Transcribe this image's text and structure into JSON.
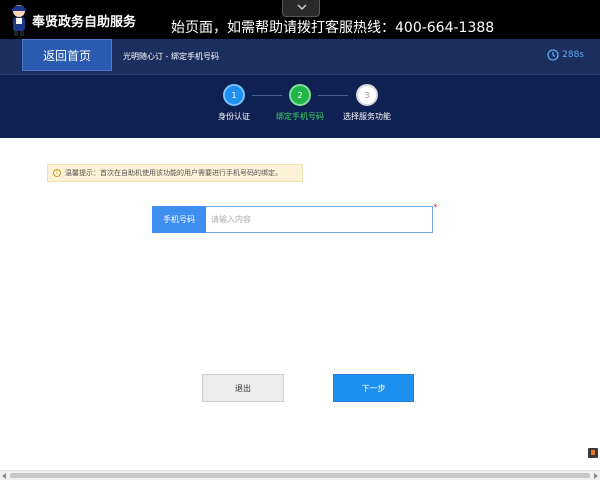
{
  "header": {
    "brand": "奉贤政务自助服务",
    "marquee": "始页面，如需帮助请拨打客服热线：400-664-1388"
  },
  "nav": {
    "back_label": "返回首页",
    "breadcrumb": "光明随心订 - 绑定手机号码",
    "timer": "288s"
  },
  "steps": [
    {
      "num": "1",
      "label": "身份认证",
      "state": "done"
    },
    {
      "num": "2",
      "label": "绑定手机号码",
      "state": "active"
    },
    {
      "num": "3",
      "label": "选择服务功能",
      "state": "pending"
    }
  ],
  "tip": {
    "text": "温馨提示：首次在自助机使用该功能的用户需要进行手机号码的绑定。"
  },
  "form": {
    "phone_label": "手机号码",
    "phone_value": "",
    "phone_placeholder": "请输入内容",
    "required_mark": "*"
  },
  "actions": {
    "exit_label": "退出",
    "next_label": "下一步"
  },
  "colors": {
    "navbar": "#1b2f5e",
    "steps_bg": "#0f2152",
    "primary": "#1e90f0",
    "step_done": "#1e8ff0",
    "step_active": "#22b64a",
    "tip_bg": "#fcf3d6"
  },
  "icons": [
    "mascot-icon",
    "chevron-down-icon",
    "clock-icon",
    "info-icon"
  ]
}
